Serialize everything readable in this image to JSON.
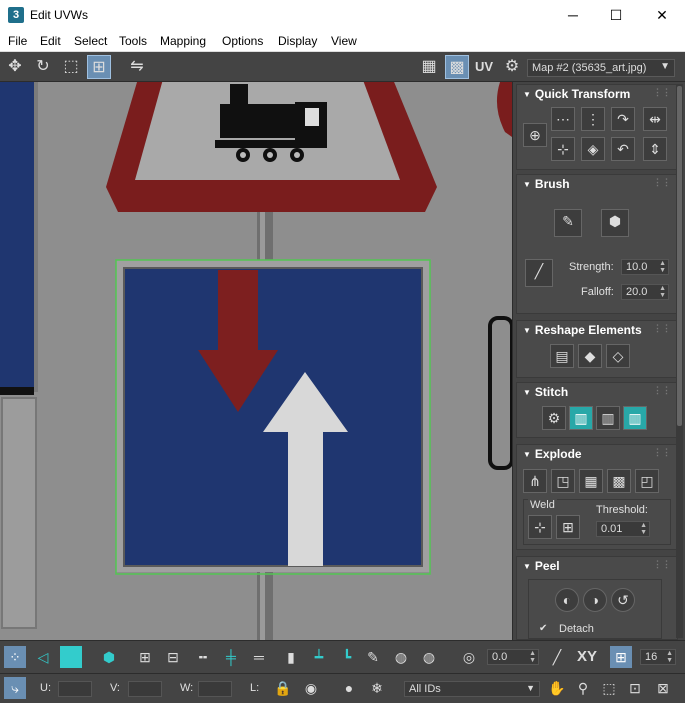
{
  "window": {
    "title": "Edit UVWs",
    "app_icon": "3",
    "minimize": "─",
    "maximize": "☐",
    "close": "✕"
  },
  "menu": [
    "File",
    "Edit",
    "Select",
    "Tools",
    "Mapping",
    "Options",
    "Display",
    "View"
  ],
  "toolbar": {
    "uv_label": "UV",
    "map_select": "Map #2 (35635_art.jpg)"
  },
  "panel": {
    "quick_transform": {
      "title": "Quick Transform"
    },
    "brush": {
      "title": "Brush",
      "strength_label": "Strength:",
      "strength_value": "10.0",
      "falloff_label": "Falloff:",
      "falloff_value": "20.0"
    },
    "reshape": {
      "title": "Reshape Elements"
    },
    "stitch": {
      "title": "Stitch"
    },
    "explode": {
      "title": "Explode",
      "weld_label": "Weld",
      "threshold_label": "Threshold:",
      "threshold_value": "0.01"
    },
    "peel": {
      "title": "Peel",
      "detach_label": "Detach"
    }
  },
  "bottom": {
    "angle_value": "0.0",
    "xy_label": "XY",
    "grid_value": "16",
    "u_label": "U:",
    "v_label": "V:",
    "w_label": "W:",
    "l_label": "L:",
    "ids_select": "All IDs"
  },
  "colors": {
    "accent": "#28a8a8",
    "selected": "#6a8fb3",
    "sign_blue": "#1f3670",
    "sign_red": "#7d1f1f",
    "selection_green": "#52c552"
  }
}
